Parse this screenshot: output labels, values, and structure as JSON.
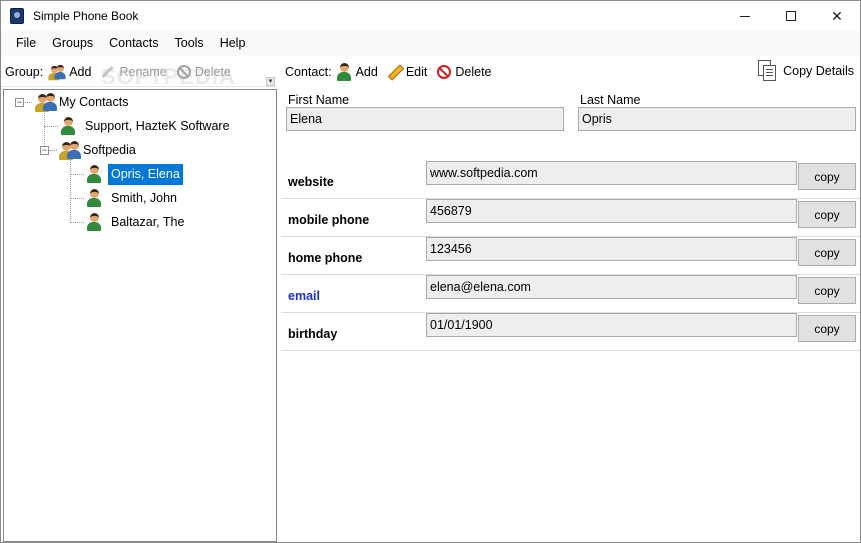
{
  "window": {
    "title": "Simple Phone Book"
  },
  "menu": [
    "File",
    "Groups",
    "Contacts",
    "Tools",
    "Help"
  ],
  "group_toolbar": {
    "label": "Group:",
    "add": "Add",
    "rename": "Rename",
    "delete": "Delete"
  },
  "contact_toolbar": {
    "label": "Contact:",
    "add": "Add",
    "edit": "Edit",
    "delete": "Delete",
    "copy_details": "Copy Details"
  },
  "watermark": "SOFTPEDIA",
  "tree": {
    "root": "My Contacts",
    "items": [
      {
        "label": "Support, HazteK Software"
      },
      {
        "label": "Softpedia"
      },
      {
        "label": "Opris, Elena"
      },
      {
        "label": "Smith, John"
      },
      {
        "label": "Baltazar, The"
      }
    ]
  },
  "contact": {
    "first_name_label": "First Name",
    "first_name": "Elena",
    "last_name_label": "Last Name",
    "last_name": "Opris"
  },
  "fields": [
    {
      "label": "website",
      "value": "www.softpedia.com",
      "button": "copy"
    },
    {
      "label": "mobile phone",
      "value": "456879",
      "button": "copy"
    },
    {
      "label": "home phone",
      "value": "123456",
      "button": "copy"
    },
    {
      "label": "email",
      "value": "elena@elena.com",
      "button": "copy"
    },
    {
      "label": "birthday",
      "value": "01/01/1900",
      "button": "copy"
    }
  ],
  "colors": {
    "selection": "#0078d7",
    "email_label": "#1a2fcf"
  }
}
